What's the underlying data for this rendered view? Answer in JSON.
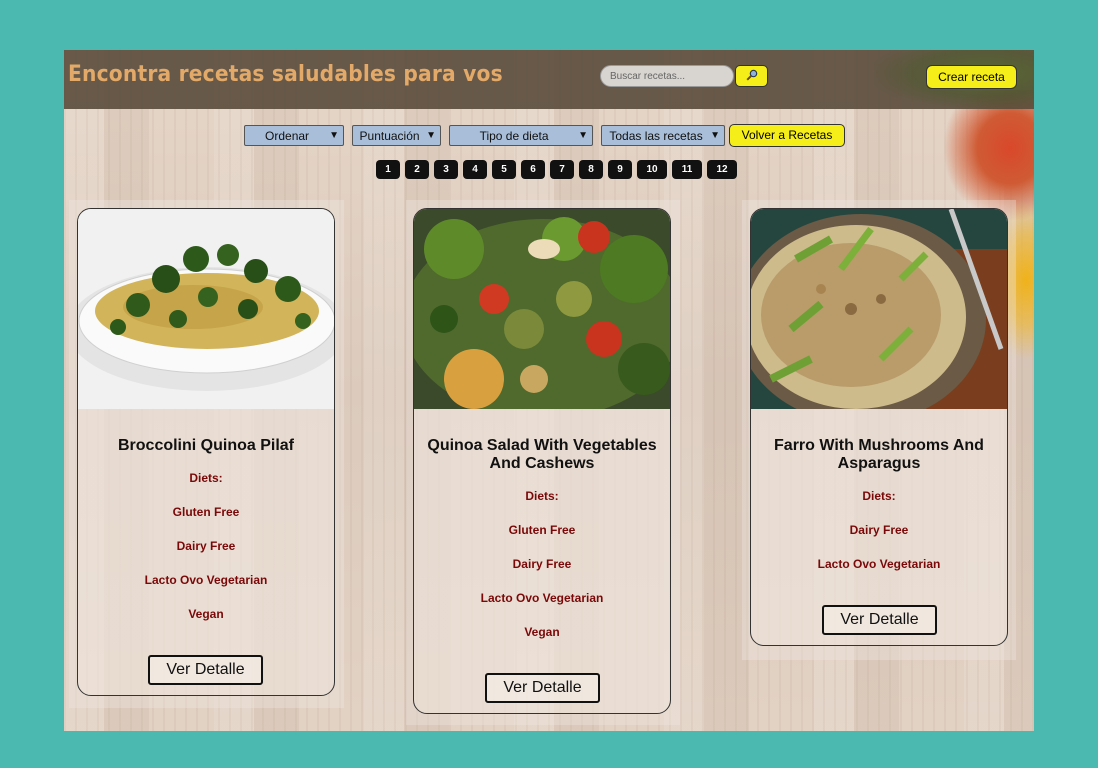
{
  "header": {
    "title": "Encontra recetas saludables para vos",
    "search_placeholder": "Buscar recetas...",
    "search_icon": "search-icon",
    "create_label": "Crear receta"
  },
  "filters": {
    "sort": "Ordenar",
    "score": "Puntuación",
    "diet_type": "Tipo de dieta",
    "all_recipes": "Todas las recetas",
    "back_label": "Volver a Recetas"
  },
  "pagination": [
    "1",
    "2",
    "3",
    "4",
    "5",
    "6",
    "7",
    "8",
    "9",
    "10",
    "11",
    "12"
  ],
  "cards": [
    {
      "title": "Broccolini Quinoa Pilaf",
      "diets_label": "Diets:",
      "diets": [
        "Gluten Free",
        "Dairy Free",
        "Lacto Ovo Vegetarian",
        "Vegan"
      ],
      "button": "Ver Detalle"
    },
    {
      "title": "Quinoa Salad With Vegetables And Cashews",
      "diets_label": "Diets:",
      "diets": [
        "Gluten Free",
        "Dairy Free",
        "Lacto Ovo Vegetarian",
        "Vegan"
      ],
      "button": "Ver Detalle"
    },
    {
      "title": "Farro With Mushrooms And Asparagus",
      "diets_label": "Diets:",
      "diets": [
        "Dairy Free",
        "Lacto Ovo Vegetarian"
      ],
      "button": "Ver Detalle"
    }
  ],
  "colors": {
    "background": "#4cb9b0",
    "accent": "#f6ee18",
    "title": "#e3a968",
    "diet": "#7a0808"
  }
}
